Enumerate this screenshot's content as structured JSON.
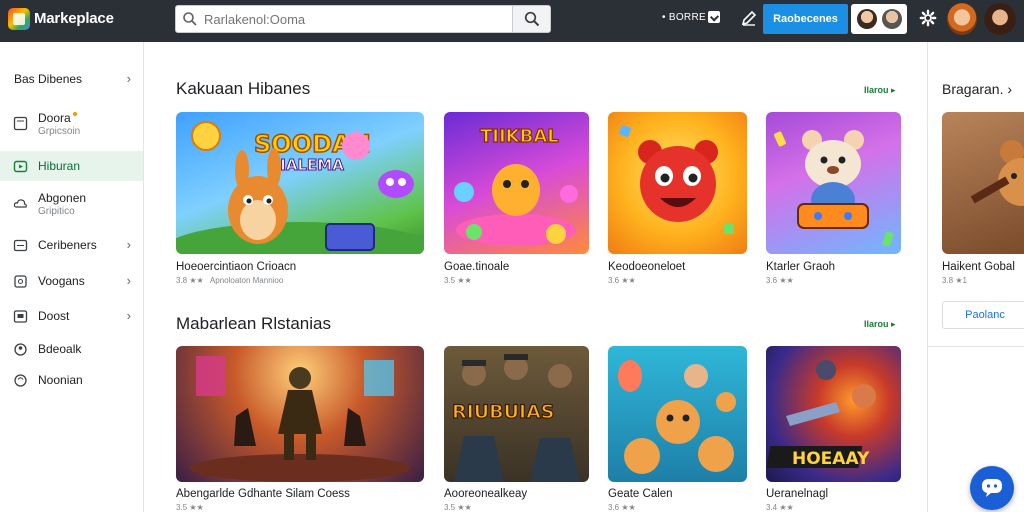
{
  "app": {
    "brand": "Markeplace",
    "search_placeholder": "Rarlakenol:Ooma",
    "store_link": "• BORRE",
    "primary_button": "Raobecenes"
  },
  "sidebar": {
    "items": [
      {
        "label": "Bas Dibenes",
        "sub": "",
        "icon": "category-icon",
        "chevron": true
      },
      {
        "label": "Doora",
        "sub": "Grpicsoin",
        "icon": "document-icon",
        "chevron": false,
        "dot": true
      },
      {
        "label": "Hiburan",
        "sub": "",
        "icon": "entertainment-icon",
        "chevron": false,
        "active": true
      },
      {
        "label": "Abgonen",
        "sub": "Gripitico",
        "icon": "cloud-icon",
        "chevron": false
      },
      {
        "label": "Ceribeners",
        "sub": "",
        "icon": "list-icon",
        "chevron": true
      },
      {
        "label": "Voogans",
        "sub": "",
        "icon": "video-icon",
        "chevron": true
      },
      {
        "label": "Doost",
        "sub": "",
        "icon": "board-icon",
        "chevron": true
      },
      {
        "label": "Bdeoalk",
        "sub": "",
        "icon": "group-icon",
        "chevron": false
      },
      {
        "label": "Noonian",
        "sub": "",
        "icon": "user-icon",
        "chevron": false
      }
    ]
  },
  "sections": [
    {
      "title": "Kakuaan Hibanes",
      "more": "Ilarou ▸",
      "cards": [
        {
          "title": "Hoeoercintiaon Crioacn",
          "rating": "3.8 ★★",
          "rating_extra": "Apnoloaton Mannioo",
          "banner": "SOODAN\nGIALEMA"
        },
        {
          "title": "Goae.tinoale",
          "rating": "3.5 ★★",
          "rating_extra": "",
          "banner": "TIIKBAL"
        },
        {
          "title": "Keodoeoneloet",
          "rating": "3.6 ★★",
          "rating_extra": "",
          "banner": ""
        },
        {
          "title": "Ktarler Graoh",
          "rating": "3.6 ★★",
          "rating_extra": "",
          "banner": ""
        }
      ]
    },
    {
      "title": "Mabarlean Rlstanias",
      "more": "Ilarou ▸",
      "cards": [
        {
          "title": "Abengarlde Gdhante Silam Coess",
          "rating": "3.5 ★★",
          "rating_extra": "",
          "banner": ""
        },
        {
          "title": "Aooreonealkeay",
          "rating": "3.5 ★★",
          "rating_extra": "",
          "banner": "RIUBUIAS"
        },
        {
          "title": "Geate  Calen",
          "rating": "3.6 ★★",
          "rating_extra": "",
          "banner": ""
        },
        {
          "title": "Ueranelnagl",
          "rating": "3.4 ★★",
          "rating_extra": "",
          "banner": "HOEAAY"
        }
      ]
    }
  ],
  "right_panel": {
    "title": "Bragaran.",
    "card_title": "Haikent Gobal",
    "card_rating": "3.8 ★1",
    "button": "Paolanc"
  }
}
